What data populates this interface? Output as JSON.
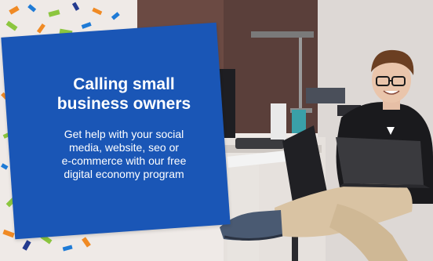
{
  "promo": {
    "title_line1": "Calling small",
    "title_line2": "business owners",
    "body_line1": "Get help with your social",
    "body_line2": "media, website, seo or",
    "body_line3": "e-commerce with our free",
    "body_line4": "digital economy program"
  },
  "colors": {
    "card_blue": "#1a56b6",
    "confetti_orange": "#f08a24",
    "confetti_green": "#8cc63f",
    "confetti_blue": "#1f7bd6",
    "confetti_navy": "#243b8f"
  },
  "scene": {
    "icons": [
      "confetti-decoration",
      "desk-lamp-icon",
      "laptop-icon",
      "monitor-icon",
      "keyboard-icon"
    ]
  }
}
